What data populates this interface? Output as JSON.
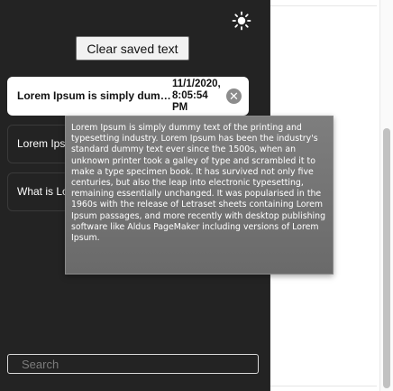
{
  "header": {
    "theme_icon": "sun-icon"
  },
  "toolbar": {
    "clear_label": "Clear saved text"
  },
  "entries": [
    {
      "text": "Lorem Ipsum is simply dummy text of the printing",
      "time": "11/1/2020, 8:05:54 PM",
      "delete_icon": "close-icon",
      "active": true
    },
    {
      "text": "Lorem Ipsum",
      "active": false
    },
    {
      "text": "What is Lorem Ipsum?",
      "active": false
    }
  ],
  "tooltip": {
    "text": "Lorem Ipsum is simply dummy text of the printing and typesetting industry. Lorem Ipsum has been the industry's standard dummy text ever since the 1500s, when an unknown printer took a galley of type and scrambled it to make a type specimen book. It has survived not only five centuries, but also the leap into electronic typesetting, remaining essentially unchanged. It was popularised in the 1960s with the release of Letraset sheets containing Lorem Ipsum passages, and more recently with desktop publishing software like Aldus PageMaker including versions of Lorem Ipsum."
  },
  "search": {
    "placeholder": "Search",
    "value": ""
  },
  "colors": {
    "popup_background": "#232323",
    "active_entry_background": "#ffffff",
    "tooltip_background": "#737373"
  }
}
